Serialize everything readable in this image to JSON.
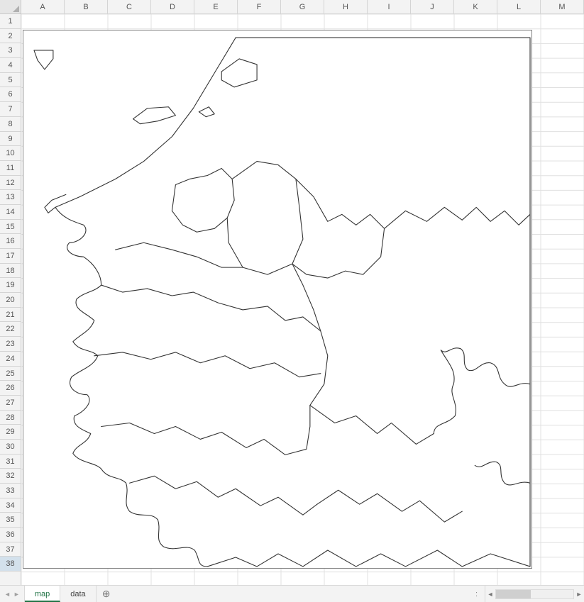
{
  "columns": [
    "A",
    "B",
    "C",
    "D",
    "E",
    "F",
    "G",
    "H",
    "I",
    "J",
    "K",
    "L",
    "M"
  ],
  "rows": [
    "1",
    "2",
    "3",
    "4",
    "5",
    "6",
    "7",
    "8",
    "9",
    "10",
    "11",
    "12",
    "13",
    "14",
    "15",
    "16",
    "17",
    "18",
    "19",
    "20",
    "21",
    "22",
    "23",
    "24",
    "25",
    "26",
    "27",
    "28",
    "29",
    "30",
    "31",
    "32",
    "33",
    "34",
    "35",
    "36",
    "37",
    "38"
  ],
  "selected_row_index": 37,
  "tabs": [
    {
      "label": "map",
      "active": true
    },
    {
      "label": "data",
      "active": false
    }
  ],
  "nav": {
    "first": "◄",
    "prev": "►"
  },
  "addsheet_glyph": "⊕",
  "menu_dots": ":",
  "hscroll": {
    "left": "◄",
    "right": "►"
  }
}
